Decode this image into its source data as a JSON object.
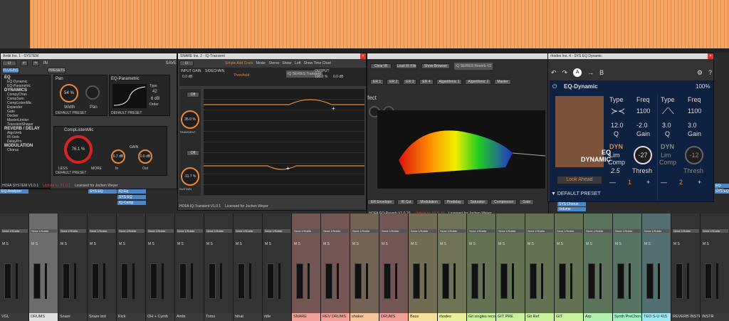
{
  "ambi": {
    "title": "Ambi Ins. 1 - SYSTEM",
    "plugins_tab": "PLUGINS",
    "presets_tab": "PRESETS",
    "save": "SAVE",
    "in": "IN",
    "categories": [
      {
        "name": "EQ",
        "items": [
          "EQ-Dynamic",
          "EQ-Parametric"
        ]
      },
      {
        "name": "DYNAMICS",
        "items": [
          "CompyChan",
          "CompSum",
          "CompListenMic",
          "Expander",
          "Gate",
          "Docker",
          "MasterLimiter",
          "TransientShaper"
        ]
      },
      {
        "name": "REVERB / DELAY",
        "items": [
          "AlgoVerb",
          "IR-Verb",
          "DelayPro"
        ]
      },
      {
        "name": "MODULATION",
        "items": [
          "Chorus"
        ]
      }
    ],
    "pan": {
      "title": "Pan",
      "value": "54 %",
      "width": "Width",
      "pan": "Pan",
      "close": "Close"
    },
    "eqp": {
      "title": "EQ-Parametric",
      "type": "Type",
      "freq": "42",
      "gain": "6 dB",
      "order": "Order",
      "order_val": "3"
    },
    "compmic": {
      "title": "CompListenMic",
      "value": "76.1 %",
      "less": "LESS",
      "more": "MORE",
      "gain": "GAIN",
      "gain_val": "6.7 dB",
      "out": "0.0 dB",
      "in": "In",
      "out_lbl": "Out",
      "mix": "Mix",
      "amount": "Amount"
    },
    "default_preset": "DEFAULT PRESET",
    "footer": "HOFA SYSTEM V1.0.1",
    "update": "Update to: V1.0.1",
    "licensed": "Licensed for Jochen Weyer"
  },
  "snare": {
    "title": "SNARE Ins. 2 - IQ-Transient",
    "mode_lbl": "Mode:",
    "mode": "Stereo",
    "show_lbl": "Show:",
    "show": "Left",
    "show_time": "Show Time Chart",
    "input_gain": "INPUT GAIN",
    "input_val": "0.0 dB",
    "sidechain": "SIDECHAIN",
    "output": "OUTPUT",
    "threshold": "Threshold",
    "output_wet": "100.0 %",
    "output_gain": "0.0 dB",
    "attack_val": "35.0 %",
    "sustain_val": "-11.7 %",
    "transient_lbl": "TRANSIENT",
    "magic_lbl": "Magic Shield",
    "sustain_lbl": "SUSTAIN",
    "off": "Off",
    "preset": "Simple Add Crack",
    "footer": "HOFA IQ-Transient V1.0.1",
    "licensed": "Licensed for Jochen Weyer",
    "logo": "IQ SERIES Transient",
    "db_ticks": [
      "20 %",
      "10 %",
      "0 %",
      "-10 %",
      "-20 %",
      "-30 %",
      "-40 %",
      "-50 %"
    ]
  },
  "reverb": {
    "title_suffix": "fect",
    "logo": "IQ SERIES Reverb V2",
    "footer": "HOFA EQ-Reverb V1.0.10",
    "update": "Update to: V1.0.10",
    "licensed": "Licensed for Jochen Weyer",
    "load_ir": "Load IR File",
    "clear_ir": "Clear IR",
    "show_browser": "Show Browser",
    "er": "ER",
    "footer_items": [
      "ER Envelope",
      "IR Cut",
      "Modulation",
      "Predelay",
      "Saturator",
      "Compressor",
      "Gate"
    ],
    "tabs": [
      "ER 1",
      "ER 2",
      "ER 3",
      "ER 4",
      "Algorithmic 1",
      "Algorithmic 2",
      "Master"
    ]
  },
  "eqdyn": {
    "title": "rhodes Ins. 4 - SYS EQ Dynamic",
    "name": "EQ-Dynamic",
    "percent": "100%",
    "ab_a": "A",
    "ab_b": "B",
    "band1": {
      "type": "Type",
      "freq": "Freq",
      "freq_val": "1100",
      "q_val": "12.0",
      "q_lbl": "Q",
      "gain_val": "-2.0",
      "gain_lbl": "Gain",
      "dyn": "DYN",
      "lim": "Lim",
      "comp": "Comp",
      "ratio": "2.5",
      "thresh_val": "-27",
      "thresh_lbl": "Thresh",
      "num": "1"
    },
    "band2": {
      "type": "Type",
      "freq": "Freq",
      "freq_val": "1100",
      "q_val": "3.0",
      "q_lbl": "Q",
      "gain_val": "3.0",
      "gain_lbl": "Gain",
      "dyn": "DYN",
      "lim": "Lim",
      "comp": "Comp",
      "thresh_val": "-12",
      "thresh_lbl": "Thresh",
      "num": "2"
    },
    "look_ahead": "Look Ahead",
    "default_preset": "DEFAULT PRESET",
    "logo_top": "EQ",
    "logo_bottom": "DYNAMIC",
    "minus": "—",
    "plus": "+"
  },
  "sends": {
    "eq_analyzer": "EQ-Analyzer",
    "sys_eq": "SYS EQ",
    "iq_eq": "IQ-Eq",
    "sys_eq2": "SYS EQ",
    "iq_comp": "IQ-Comp",
    "sys_chorus": "SYS Chorus",
    "volume": "Volume",
    "eq_dyn": "EQ-Dyna",
    "sys_eq3": "SYS EQ"
  },
  "mixer": {
    "channels": [
      {
        "name": "VGL",
        "color": "#3a3a3a"
      },
      {
        "name": "DRUMS",
        "color": "#e0e0e0"
      },
      {
        "name": "Snare",
        "color": "#3a3a3a"
      },
      {
        "name": "Snare bot",
        "color": "#3a3a3a"
      },
      {
        "name": "Kick",
        "color": "#3a3a3a"
      },
      {
        "name": "OH + Cymb",
        "color": "#3a3a3a"
      },
      {
        "name": "Ambi",
        "color": "#3a3a3a"
      },
      {
        "name": "Toms",
        "color": "#3a3a3a"
      },
      {
        "name": "hihat",
        "color": "#3a3a3a"
      },
      {
        "name": "ride",
        "color": "#3a3a3a"
      },
      {
        "name": "SNARE",
        "color": "#f4a09a"
      },
      {
        "name": "REV DRUMS",
        "color": "#f4a09a"
      },
      {
        "name": "shaker",
        "color": "#f4c59a"
      },
      {
        "name": "DRUMS",
        "color": "#f4a09a"
      },
      {
        "name": "Bass",
        "color": "#f4e09a"
      },
      {
        "name": "rhodes",
        "color": "#e8f09a"
      },
      {
        "name": "Git singles recorded",
        "color": "#c9f09a"
      },
      {
        "name": "GIT PRE",
        "color": "#c9f09a"
      },
      {
        "name": "Git Ref",
        "color": "#c9f09a"
      },
      {
        "name": "GIT",
        "color": "#c9f09a"
      },
      {
        "name": "Arp",
        "color": "#b0f0b0"
      },
      {
        "name": "Synth PreChorus",
        "color": "#a0f0c0"
      },
      {
        "name": "TEO S-U 415",
        "color": "#9ae8f0"
      },
      {
        "name": "REVERB INSTR",
        "color": "#3a3a3a"
      },
      {
        "name": "INSTR",
        "color": "#3a3a3a"
      }
    ],
    "send_label": "Send 1/Snbbr",
    "ms_label": "M S"
  }
}
